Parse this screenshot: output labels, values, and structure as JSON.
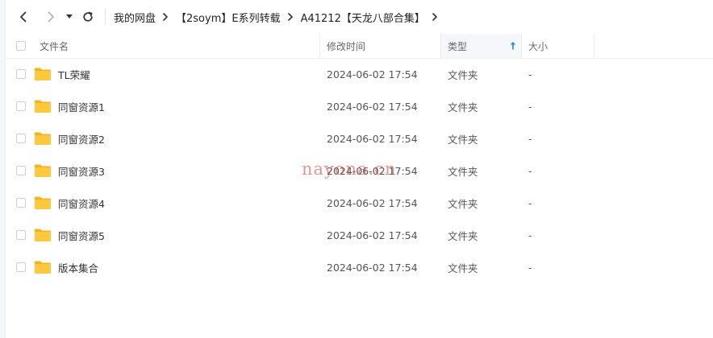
{
  "breadcrumb": {
    "items": [
      "我的网盘",
      "【2soym】E系列转载",
      "A41212【天龙八部合集】"
    ]
  },
  "table": {
    "headers": {
      "name": "文件名",
      "date": "修改时间",
      "type": "类型",
      "size": "大小"
    },
    "sort": {
      "column": "type",
      "direction": "ascending"
    },
    "rows": [
      {
        "name": "TL荣耀",
        "date": "2024-06-02 17:54",
        "type": "文件夹",
        "size": "-"
      },
      {
        "name": "同窗资源1",
        "date": "2024-06-02 17:54",
        "type": "文件夹",
        "size": "-"
      },
      {
        "name": "同窗资源2",
        "date": "2024-06-02 17:54",
        "type": "文件夹",
        "size": "-"
      },
      {
        "name": "同窗资源3",
        "date": "2024-06-02 17:54",
        "type": "文件夹",
        "size": "-"
      },
      {
        "name": "同窗资源4",
        "date": "2024-06-02 17:54",
        "type": "文件夹",
        "size": "-"
      },
      {
        "name": "同窗资源5",
        "date": "2024-06-02 17:54",
        "type": "文件夹",
        "size": "-"
      },
      {
        "name": "版本集合",
        "date": "2024-06-02 17:54",
        "type": "文件夹",
        "size": "-"
      }
    ]
  },
  "watermark": {
    "text": "nayona.cn"
  },
  "icons": {
    "back": "chevron-left-icon",
    "forward": "chevron-right-icon",
    "dropdown": "caret-down-icon",
    "refresh": "refresh-icon",
    "crumb_separator": "chevron-right-icon",
    "sort": "arrow-up-icon",
    "folder": "folder-icon"
  },
  "colors": {
    "folder": "#ffc83d",
    "folder_tab": "#f3b21f",
    "sort_arrow": "#1e88e5",
    "watermark": "#d63c3c"
  }
}
